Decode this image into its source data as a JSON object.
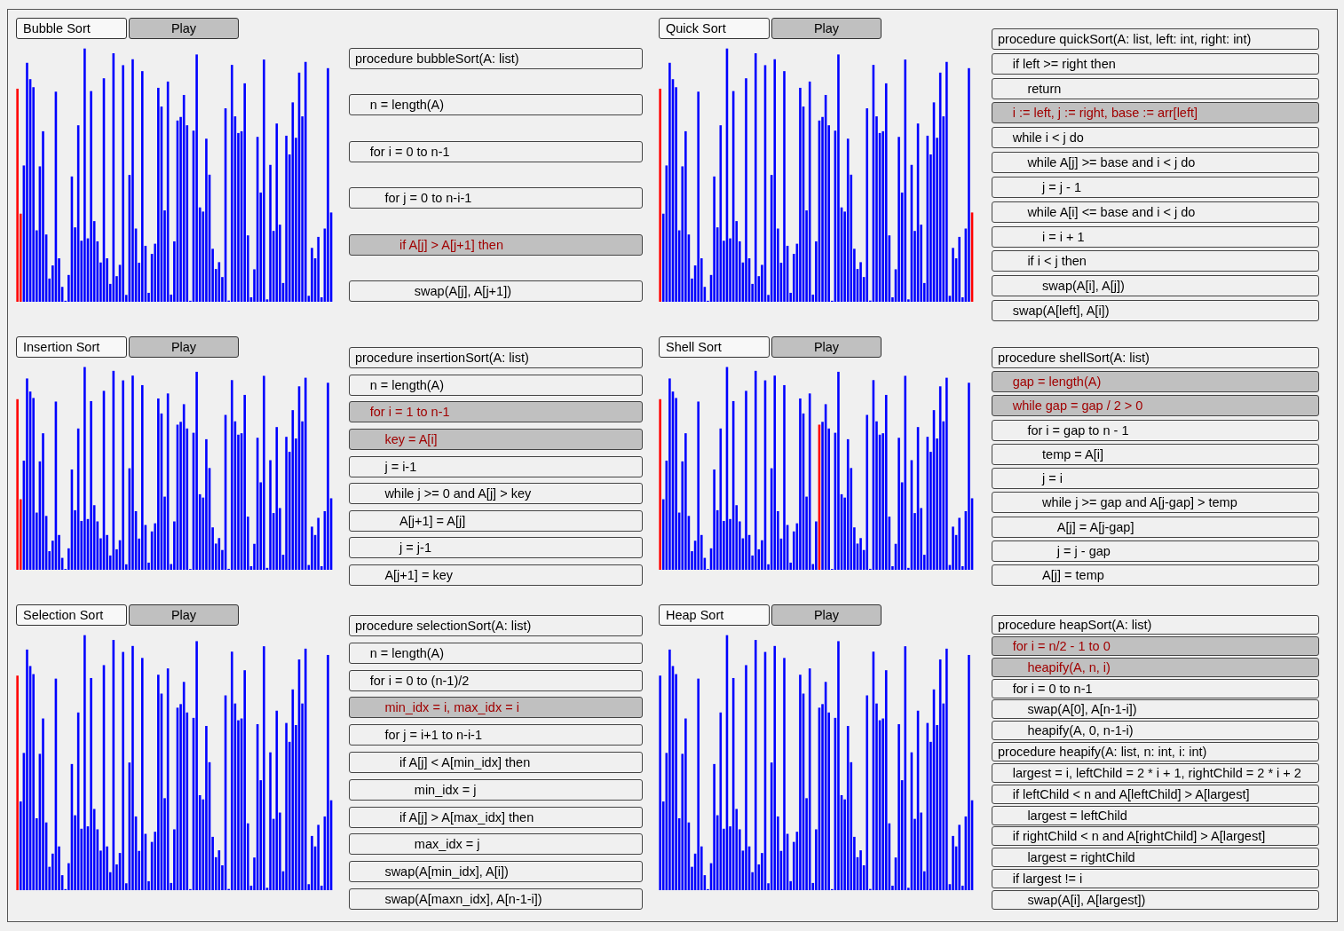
{
  "sections": [
    {
      "title": "Bubble Sort",
      "button": "Play",
      "code": [
        {
          "text": "procedure bubbleSort(A: list)",
          "current": false,
          "children": [
            {
              "text": "n = length(A)",
              "current": false
            },
            {
              "text": "for i = 0 to n-1",
              "current": false,
              "children": [
                {
                  "text": "for j = 0 to n-i-1",
                  "current": false,
                  "children": [
                    {
                      "text": "if A[j] > A[j+1] then",
                      "current": true,
                      "children": [
                        {
                          "text": "swap(A[j], A[j+1])",
                          "current": false
                        }
                      ]
                    }
                  ]
                }
              ]
            }
          ]
        }
      ]
    },
    {
      "title": "Quick Sort",
      "button": "Play",
      "code": [
        {
          "text": "procedure quickSort(A: list, left: int, right: int)",
          "current": false,
          "children": [
            {
              "text": "if left >= right then",
              "current": false,
              "children": [
                {
                  "text": "return",
                  "current": false
                }
              ]
            },
            {
              "text": "i := left, j := right, base := arr[left]",
              "current": true
            },
            {
              "text": "while i < j do",
              "current": false,
              "children": [
                {
                  "text": "while A[j] >= base and i < j do",
                  "current": false,
                  "children": [
                    {
                      "text": "j = j - 1",
                      "current": false
                    }
                  ]
                },
                {
                  "text": "while A[i] <= base and i < j do",
                  "current": false,
                  "children": [
                    {
                      "text": "i = i + 1",
                      "current": false
                    }
                  ]
                },
                {
                  "text": "if i < j then",
                  "current": false,
                  "children": [
                    {
                      "text": "swap(A[i], A[j])",
                      "current": false
                    }
                  ]
                }
              ]
            },
            {
              "text": "swap(A[left], A[i])",
              "current": false
            }
          ]
        }
      ]
    },
    {
      "title": "Insertion Sort",
      "button": "Play",
      "code": [
        {
          "text": "procedure insertionSort(A: list)",
          "current": false,
          "children": [
            {
              "text": "n = length(A)",
              "current": false
            },
            {
              "text": "for i = 1 to n-1",
              "current": true,
              "children": [
                {
                  "text": "key = A[i]",
                  "current": true
                },
                {
                  "text": "j = i-1",
                  "current": false
                },
                {
                  "text": "while j >= 0 and A[j] > key",
                  "current": false,
                  "children": [
                    {
                      "text": "A[j+1] = A[j]",
                      "current": false
                    },
                    {
                      "text": "j = j-1",
                      "current": false
                    }
                  ]
                },
                {
                  "text": "A[j+1] = key",
                  "current": false
                }
              ]
            }
          ]
        }
      ]
    },
    {
      "title": "Shell Sort",
      "button": "Play",
      "code": [
        {
          "text": "procedure shellSort(A: list)",
          "current": false,
          "children": [
            {
              "text": "gap = length(A)",
              "current": true
            },
            {
              "text": "while gap = gap / 2 > 0",
              "current": true,
              "children": [
                {
                  "text": "for i = gap to n - 1",
                  "current": false,
                  "children": [
                    {
                      "text": "temp = A[i]",
                      "current": false
                    },
                    {
                      "text": "j = i",
                      "current": false
                    },
                    {
                      "text": "while j >= gap and A[j-gap] > temp",
                      "current": false,
                      "children": [
                        {
                          "text": "A[j] = A[j-gap]",
                          "current": false
                        },
                        {
                          "text": "j = j - gap",
                          "current": false
                        }
                      ]
                    },
                    {
                      "text": "A[j] = temp",
                      "current": false
                    }
                  ]
                }
              ]
            }
          ]
        }
      ]
    },
    {
      "title": "Selection Sort",
      "button": "Play",
      "code": [
        {
          "text": "procedure selectionSort(A: list)",
          "current": false,
          "children": [
            {
              "text": "n = length(A)",
              "current": false
            },
            {
              "text": "for i = 0 to (n-1)/2",
              "current": false,
              "children": [
                {
                  "text": "min_idx = i, max_idx = i",
                  "current": true
                },
                {
                  "text": "for j = i+1 to n-i-1",
                  "current": false,
                  "children": [
                    {
                      "text": "if A[j] < A[min_idx] then",
                      "current": false,
                      "children": [
                        {
                          "text": "min_idx = j",
                          "current": false
                        }
                      ]
                    },
                    {
                      "text": "if A[j] > A[max_idx] then",
                      "current": false,
                      "children": [
                        {
                          "text": "max_idx = j",
                          "current": false
                        }
                      ]
                    }
                  ]
                },
                {
                  "text": "swap(A[min_idx], A[i])",
                  "current": false
                },
                {
                  "text": "swap(A[maxn_idx], A[n-1-i])",
                  "current": false
                }
              ]
            }
          ]
        }
      ]
    },
    {
      "title": "Heap Sort",
      "button": "Play",
      "code": [
        {
          "text": "procedure heapSort(A: list)",
          "current": false,
          "children": [
            {
              "text": "for i = n/2 - 1 to 0",
              "current": true,
              "children": [
                {
                  "text": "heapify(A, n, i)",
                  "current": true
                }
              ]
            },
            {
              "text": "for i = 0 to n-1",
              "current": false,
              "children": [
                {
                  "text": "swap(A[0], A[n-1-i])",
                  "current": false
                },
                {
                  "text": "heapify(A, 0, n-1-i)",
                  "current": false
                }
              ]
            }
          ]
        },
        {
          "text": "procedure heapify(A: list, n: int, i: int)",
          "current": false,
          "children": [
            {
              "text": "largest = i, leftChild = 2 * i + 1, rightChild = 2 * i + 2",
              "current": false
            },
            {
              "text": "if leftChild < n and A[leftChild] > A[largest]",
              "current": false,
              "children": [
                {
                  "text": "largest = leftChild",
                  "current": false
                }
              ]
            },
            {
              "text": "if rightChild < n and A[rightChild] > A[largest]",
              "current": false,
              "children": [
                {
                  "text": "largest = rightChild",
                  "current": false
                }
              ]
            },
            {
              "text": "if largest != i",
              "current": false,
              "children": [
                {
                  "text": "swap(A[i], A[largest])",
                  "current": false
                }
              ]
            }
          ]
        }
      ]
    }
  ]
}
